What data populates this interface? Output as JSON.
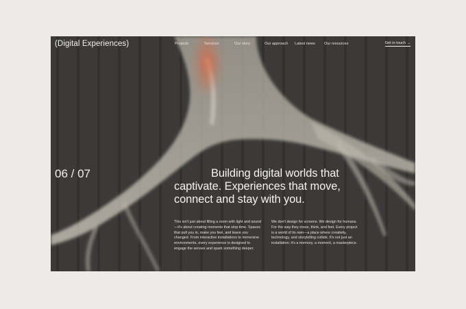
{
  "header": {
    "brand": "(Digital Experiences)",
    "nav": [
      "Projects",
      "Services",
      "Our story",
      "Our approach",
      "Latest news",
      "Our resources"
    ],
    "cta": "Get in touch →"
  },
  "hero": {
    "counter": "06 / 07",
    "headline_lines": [
      "Building digital worlds that",
      "captivate. Experiences that move,",
      "connect and stay with you."
    ],
    "body_left": "This isn't just about filling a room with light and sound—it's about creating moments that stop time. Spaces that pull you in, make you feel, and leave you changed. From interactive installations to immersive environments, every experience is designed to engage the senses and spark something deeper.",
    "body_right": "We don't design for screens. We design for humans. For the way they move, think, and feel. Every project is a world of its own—a place where creativity, technology, and storytelling collide. It's not just an installation; it's a memory, a moment, a masterpiece."
  },
  "colors": {
    "page_background": "#ecebe8",
    "hero_background": "#3a3937",
    "accent": "#d8683f",
    "text": "#f2f1ee"
  }
}
